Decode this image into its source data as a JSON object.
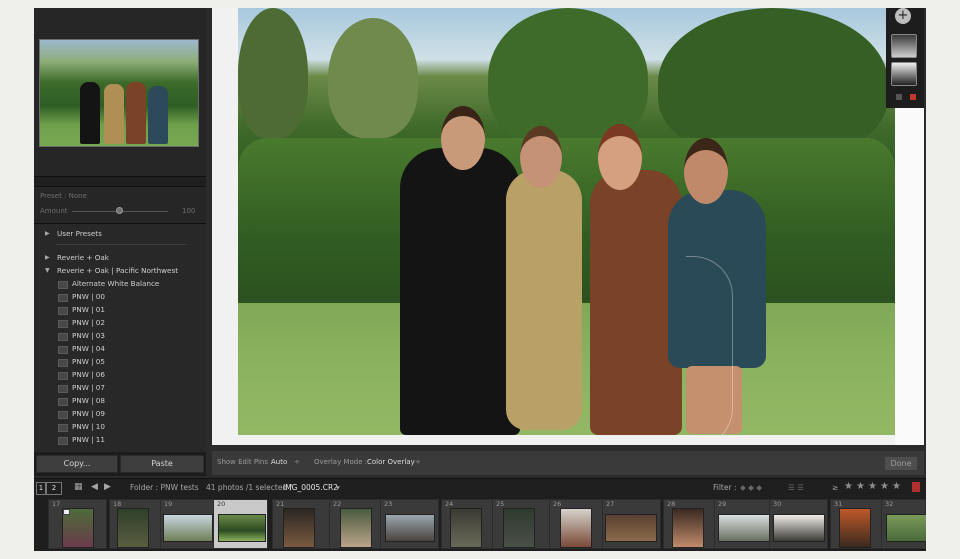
{
  "left_panel": {
    "preset_label": "Preset : None",
    "amount_label": "Amount",
    "amount_value": "100",
    "amount_level": 0.5,
    "tree": [
      {
        "type": "group",
        "label": "User Presets",
        "expanded": false
      },
      {
        "type": "group",
        "label": "Reverie + Oak",
        "expanded": false
      },
      {
        "type": "group",
        "label": "Reverie + Oak | Pacific Northwest",
        "expanded": true
      }
    ],
    "presets": [
      "Alternate White Balance",
      "PNW | 00",
      "PNW | 01",
      "PNW | 02",
      "PNW | 03",
      "PNW | 04",
      "PNW | 05",
      "PNW | 06",
      "PNW | 07",
      "PNW | 08",
      "PNW | 09",
      "PNW | 10",
      "PNW | 11"
    ],
    "copy_button": "Copy...",
    "paste_button": "Paste"
  },
  "center_toolbar": {
    "edit_pins_label": "Show Edit Pins :",
    "edit_pins_value": "Auto",
    "overlay_label": "Overlay Mode :",
    "overlay_value": "Color Overlay",
    "done_button": "Done"
  },
  "filmstrip_bar": {
    "second_window": "2",
    "folder_text": "Folder : PNW tests",
    "count_text": "41 photos /1 selected /",
    "filename": "IMG_0005.CR2",
    "filter_label": "Filter :",
    "rating_min": 1
  },
  "filmstrip": {
    "selected_index": 3,
    "numbers": [
      "17",
      "18",
      "19",
      "20",
      "21",
      "22",
      "23",
      "24",
      "25",
      "26",
      "27",
      "28",
      "29",
      "30",
      "31",
      "32"
    ]
  },
  "colors": {
    "panel": "#1f1f1f",
    "selected_cell": "#c9c9c9",
    "done_button": "#4e4e4e"
  },
  "icons": {
    "grid": "grid-view-icon",
    "prev": "arrow-left-icon",
    "next": "arrow-right-icon",
    "add_mask": "plus-icon"
  }
}
